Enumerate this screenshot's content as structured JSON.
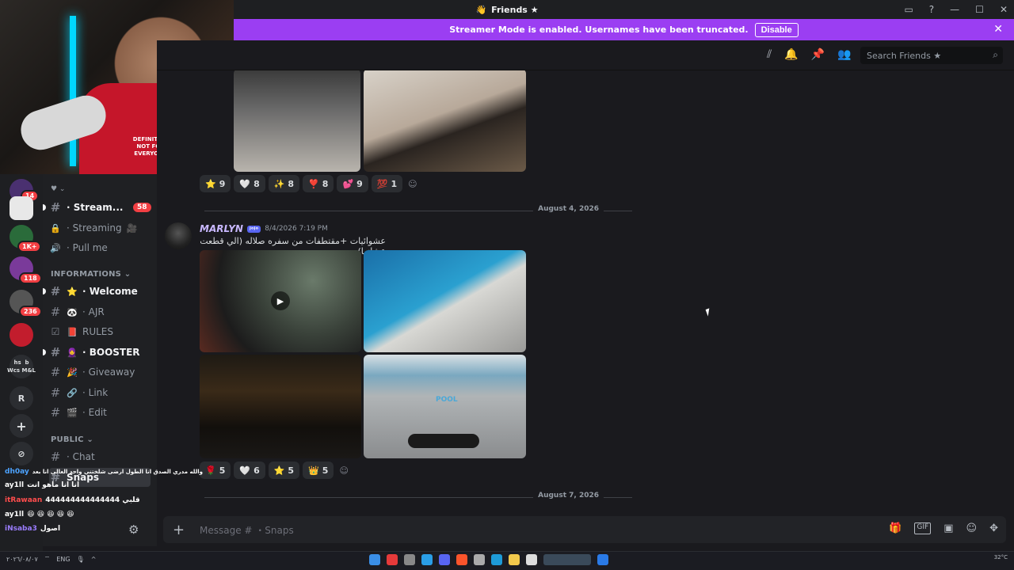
{
  "window": {
    "title": "Friends ★",
    "controls": [
      "—",
      "☐",
      "✕"
    ]
  },
  "banner": {
    "text": "Streamer Mode is enabled. Usernames have been truncated.",
    "button": "Disable",
    "color": "#9b3ef2"
  },
  "webcam": {
    "shirt_text": "DEFINITELY NOT FOR EVERYONE"
  },
  "servers": [
    {
      "label": "",
      "badge": "14"
    },
    {
      "label": "",
      "badge": ""
    },
    {
      "label": "",
      "badge": "1K+"
    },
    {
      "label": "",
      "badge": "118"
    },
    {
      "label": "",
      "badge": "236"
    },
    {
      "label": "",
      "badge": ""
    },
    {
      "label": "hs  b\nWcs M&L",
      "badge": ""
    },
    {
      "label": "R",
      "badge": ""
    },
    {
      "label": "+",
      "badge": ""
    },
    {
      "label": "⊘",
      "badge": ""
    }
  ],
  "channels": {
    "top_items": [
      {
        "name": "· Stream...",
        "icon": "#",
        "emoji": "",
        "bold": true,
        "mention": "58"
      },
      {
        "name": "· Streaming",
        "icon": "🔒",
        "emoji": "🎥",
        "bold": false,
        "mention": ""
      },
      {
        "name": "· Pull me",
        "icon": "🔊",
        "emoji": "",
        "bold": false,
        "mention": ""
      }
    ],
    "cat1": "INFORMATIONS ⌄",
    "info_items": [
      {
        "name": "· Welcome",
        "icon": "#",
        "emoji": "⭐",
        "bold": true
      },
      {
        "name": "· AJR",
        "icon": "#",
        "emoji": "🐼",
        "bold": false
      },
      {
        "name": "RULES",
        "icon": "☑",
        "emoji": "📕",
        "bold": false
      },
      {
        "name": "· BOOSTER",
        "icon": "#",
        "emoji": "🧕",
        "bold": true
      },
      {
        "name": "· Giveaway",
        "icon": "#",
        "emoji": "🎉",
        "bold": false
      },
      {
        "name": "· Link",
        "icon": "#",
        "emoji": "🔗",
        "bold": false
      },
      {
        "name": "· Edit",
        "icon": "#",
        "emoji": "🎬",
        "bold": false
      }
    ],
    "cat2": "PUBLIC ⌄",
    "public_items": [
      {
        "name": "· Chat",
        "icon": "#",
        "emoji": "",
        "bold": false
      },
      {
        "name": "Snaps",
        "icon": "#",
        "emoji": "",
        "bold": true
      }
    ]
  },
  "toolbar": {
    "search_placeholder": "Search Friends ★"
  },
  "messages": {
    "reactions_top": [
      {
        "emoji": "⭐",
        "count": "9"
      },
      {
        "emoji": "🤍",
        "count": "8"
      },
      {
        "emoji": "✨",
        "count": "8"
      },
      {
        "emoji": "❣️",
        "count": "8"
      },
      {
        "emoji": "💕",
        "count": "9"
      },
      {
        "emoji": "💯",
        "count": "1"
      }
    ],
    "date1": "August 4, 2026",
    "author": "MARLYN",
    "author_tag": "ʲᵒʲᵒ",
    "timestamp": "8/4/2026 7:19 PM",
    "text": "عشوائيات +مقتطفات من سفره صلاله (الي قطعت عشانها)",
    "reactions_bottom": [
      {
        "emoji": "🌹",
        "count": "5"
      },
      {
        "emoji": "🤍",
        "count": "6"
      },
      {
        "emoji": "⭐",
        "count": "5"
      },
      {
        "emoji": "👑",
        "count": "5"
      }
    ],
    "date2": "August 7, 2026",
    "pool_label": "POOL"
  },
  "composer": {
    "placeholder": "Message # ・Snaps"
  },
  "stream_chat": [
    {
      "user": "dh0ay",
      "color": "#4da3ff",
      "text": "والله مدري الصدق انا الطول ارضى شلختني واحد العالي انا بعد"
    },
    {
      "user": "ay1ll",
      "color": "#ffffff",
      "text": "انا انا ماهو انت"
    },
    {
      "user": "itRawaan",
      "color": "#ff4d4d",
      "text": "قلبي 444444444444444"
    },
    {
      "user": "ay1ll",
      "color": "#ffffff",
      "text": "😆 😆 😆 😆 😆"
    },
    {
      "user": "iNsaba3",
      "color": "#9b7dff",
      "text": "اصول"
    }
  ],
  "taskbar": {
    "lang": "ENG",
    "temp": "32°C",
    "date": "٢٠٢٦/٠٨/٠٧"
  }
}
